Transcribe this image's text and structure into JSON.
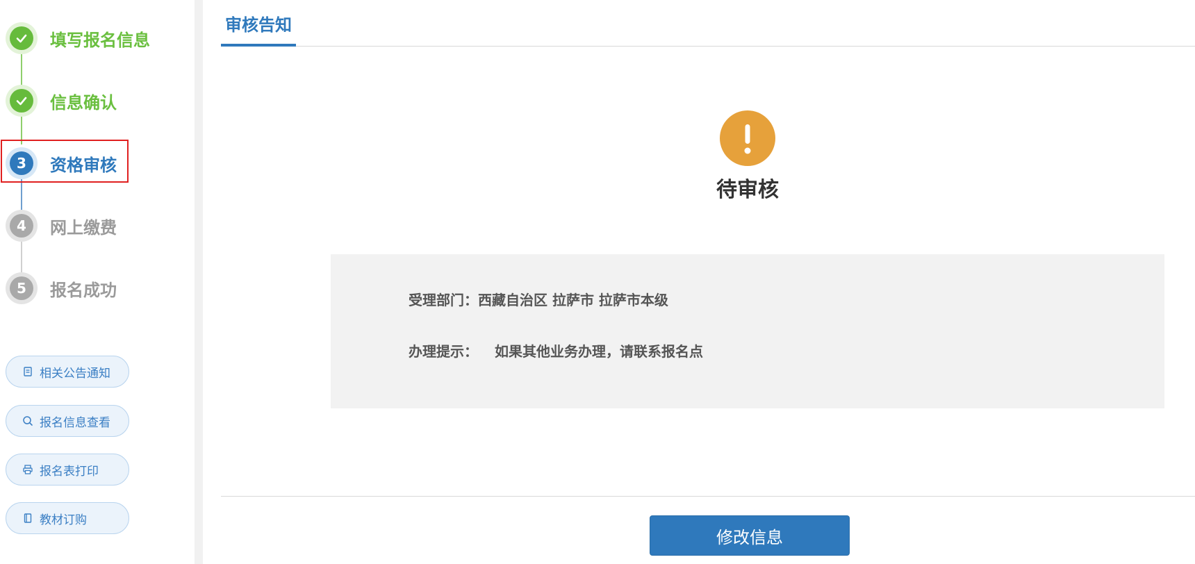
{
  "steps": [
    {
      "number": "1",
      "label": "填写报名信息",
      "state": "done"
    },
    {
      "number": "2",
      "label": "信息确认",
      "state": "done"
    },
    {
      "number": "3",
      "label": "资格审核",
      "state": "current"
    },
    {
      "number": "4",
      "label": "网上缴费",
      "state": "todo"
    },
    {
      "number": "5",
      "label": "报名成功",
      "state": "todo"
    }
  ],
  "side_buttons": [
    {
      "label": "相关公告通知",
      "icon": "document-icon"
    },
    {
      "label": "报名信息查看",
      "icon": "search-icon"
    },
    {
      "label": "报名表打印",
      "icon": "printer-icon"
    },
    {
      "label": "教材订购",
      "icon": "book-icon"
    }
  ],
  "main": {
    "tab_label": "审核告知",
    "status_title": "待审核",
    "status_icon": "exclamation-icon",
    "dept_label": "受理部门：",
    "dept_value": "西藏自治区 拉萨市 拉萨市本级",
    "tip_label": "办理提示：",
    "tip_value": "如果其他业务办理，请联系报名点",
    "modify_button": "修改信息"
  },
  "colors": {
    "done": "#66bb3c",
    "current": "#2f79bc",
    "todo": "#a9a9a9",
    "warning": "#e6a13b",
    "primary": "#2f79bc"
  }
}
